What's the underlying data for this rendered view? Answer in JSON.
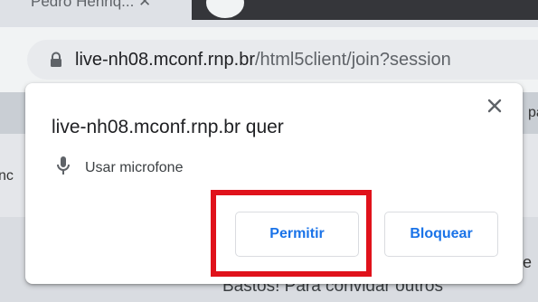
{
  "browser": {
    "tab_title_fragment": "Pedro Henriq... ✕",
    "omnibox": {
      "host": "live-nh08.mconf.rnp.br",
      "path": "/html5client/join?session"
    }
  },
  "page_background": {
    "fragment_right_top": "pa",
    "fragment_left": "nc",
    "fragment_right_bottom": "e",
    "fragment_bottom": "Bastos! Para convidar outros"
  },
  "permission_dialog": {
    "title": "live-nh08.mconf.rnp.br quer",
    "permission_label": "Usar microfone",
    "allow_label": "Permitir",
    "block_label": "Bloquear"
  },
  "annotation": {
    "highlight_color": "#e0121b"
  },
  "colors": {
    "accent": "#1a73e8",
    "chrome_frame": "#dee1e6",
    "toolbar": "#f1f3f4"
  }
}
